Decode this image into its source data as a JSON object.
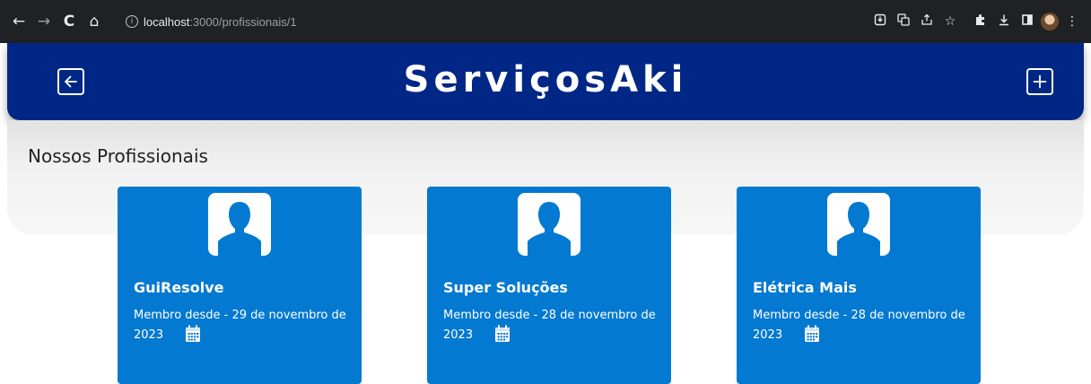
{
  "browser": {
    "url_host": "localhost",
    "url_rest": ":3000/profissionais/1",
    "info_glyph": "i",
    "nav_back": "←",
    "nav_forward": "→",
    "nav_reload": "C",
    "nav_home": "⌂",
    "star_glyph": "☆",
    "menu_glyph": "⋮"
  },
  "header": {
    "title": "ServiçosAki",
    "back_icon": "arrow-left-icon",
    "add_icon": "plus-square-icon",
    "color": "#002786"
  },
  "section": {
    "title": "Nossos Profissionais"
  },
  "cards": [
    {
      "name": "GuiResolve",
      "since_text": "Membro desde - 29 de novembro de",
      "year": "2023"
    },
    {
      "name": "Super Soluções",
      "since_text": "Membro desde - 28 de novembro de",
      "year": "2023"
    },
    {
      "name": "Elétrica Mais",
      "since_text": "Membro desde - 28 de novembro de",
      "year": "2023"
    }
  ],
  "colors": {
    "card": "#0379d1",
    "accent": "#002786"
  }
}
